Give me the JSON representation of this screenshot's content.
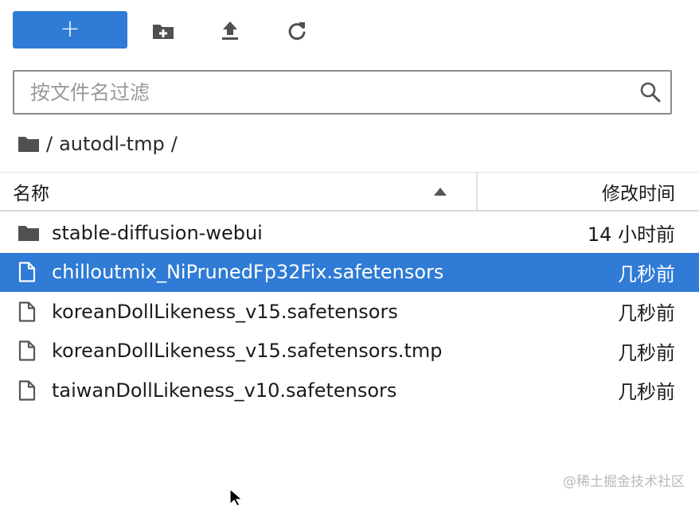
{
  "toolbar": {
    "new_label": "+",
    "icons": [
      "new-folder-icon",
      "upload-icon",
      "refresh-icon"
    ]
  },
  "filter": {
    "placeholder": "按文件名过滤",
    "value": ""
  },
  "breadcrumb": {
    "root_sep": "/",
    "folder": "autodl-tmp",
    "trail_sep": "/"
  },
  "table": {
    "col_name": "名称",
    "col_modified": "修改时间",
    "rows": [
      {
        "type": "folder",
        "name": "stable-diffusion-webui",
        "modified": "14 小时前"
      },
      {
        "type": "file",
        "name": "chilloutmix_NiPrunedFp32Fix.safetensors",
        "modified": "几秒前",
        "selected": true
      },
      {
        "type": "file",
        "name": "koreanDollLikeness_v15.safetensors",
        "modified": "几秒前"
      },
      {
        "type": "file",
        "name": "koreanDollLikeness_v15.safetensors.tmp",
        "modified": "几秒前"
      },
      {
        "type": "file",
        "name": "taiwanDollLikeness_v10.safetensors",
        "modified": "几秒前"
      }
    ]
  },
  "watermark": "@稀土掘金技术社区",
  "colors": {
    "accent": "#2f7bd5",
    "text": "#1b1b1b",
    "icon": "#555555"
  }
}
